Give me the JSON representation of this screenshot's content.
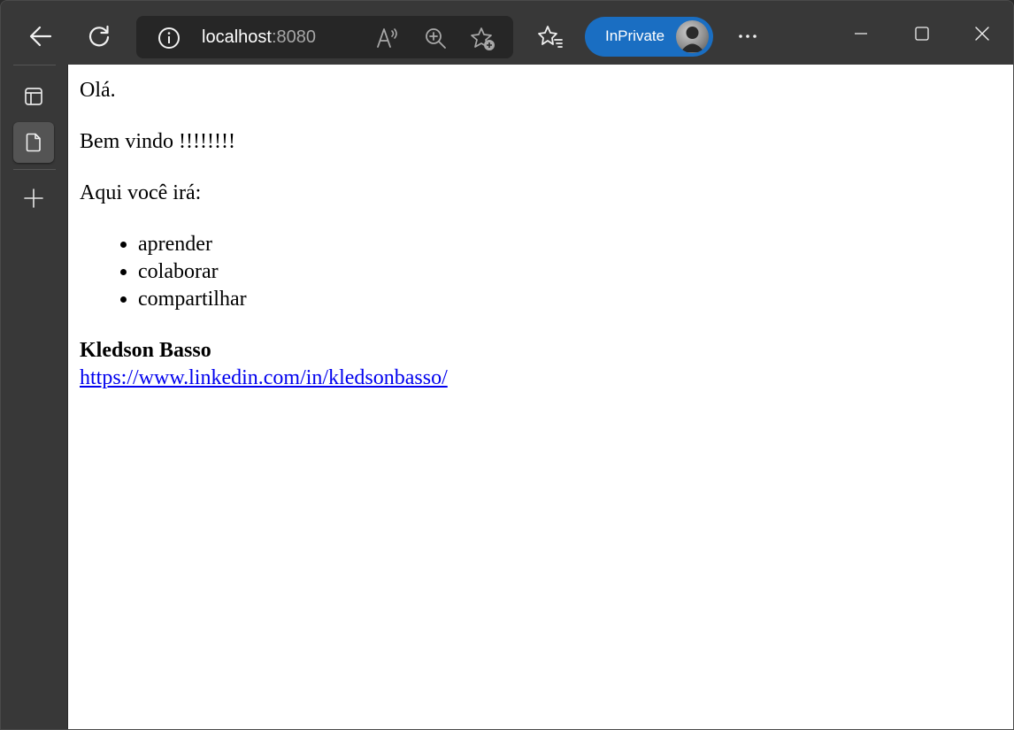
{
  "browser": {
    "address": {
      "host": "localhost",
      "port": ":8080"
    },
    "inprivate_label": "InPrivate",
    "icons": {
      "back": "back-arrow-icon",
      "refresh": "refresh-icon",
      "info": "info-icon",
      "read_aloud": "read-aloud-icon",
      "zoom": "zoom-in-icon",
      "add_favorite": "add-favorite-icon",
      "favorites": "favorites-icon",
      "more": "more-icon",
      "minimize": "minimize-icon",
      "maximize": "maximize-icon",
      "close": "close-icon",
      "tab_actions": "tab-actions-icon",
      "page": "page-icon",
      "new_tab": "plus-icon"
    },
    "colors": {
      "inprivate": "#1a6ec2",
      "toolbar": "#383838",
      "link": "#0000ee"
    }
  },
  "page": {
    "greeting": "Olá.",
    "welcome": "Bem vindo !!!!!!!!",
    "intro": "Aqui você irá:",
    "list": [
      "aprender",
      "colaborar",
      "compartilhar"
    ],
    "author_name": "Kledson Basso",
    "author_link": "https://www.linkedin.com/in/kledsonbasso/"
  }
}
